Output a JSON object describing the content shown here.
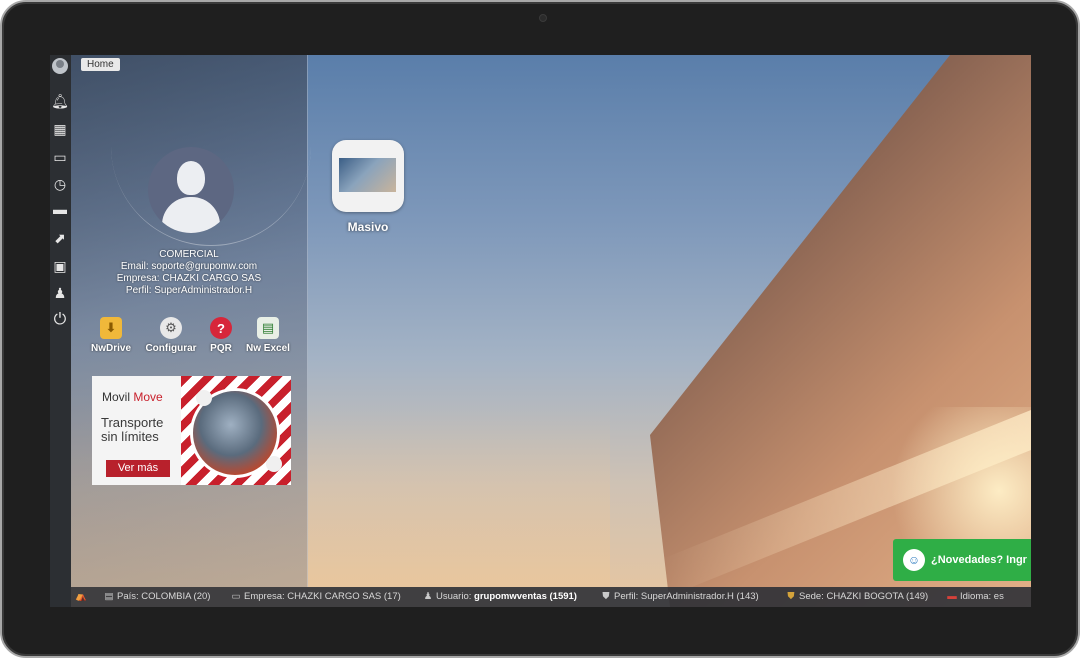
{
  "tabs": {
    "home": "Home"
  },
  "profile": {
    "role": "COMERCIAL",
    "email": "Email: soporte@grupomw.com",
    "company": "Empresa: CHAZKI CARGO SAS",
    "profile": "Perfil: SuperAdministrador.H"
  },
  "quick_actions": [
    {
      "label": "NwDrive",
      "icon": "drive-icon"
    },
    {
      "label": "Configurar",
      "icon": "gear-icon"
    },
    {
      "label": "PQR",
      "icon": "help-icon"
    },
    {
      "label": "Nw Excel",
      "icon": "excel-icon"
    }
  ],
  "ad": {
    "brand_a": "Movil ",
    "brand_b": "Move",
    "title_line1": "Transporte",
    "title_line2": "sin límites",
    "button": "Ver más"
  },
  "desktop": {
    "app_label": "Masivo"
  },
  "news": {
    "label": "¿Novedades? Ingr"
  },
  "statusbar": {
    "pais": "País: COLOMBIA (20)",
    "empresa": "Empresa: CHAZKI CARGO SAS (17)",
    "usuario_prefix": "Usuario: ",
    "usuario_value": "grupomwventas (1591)",
    "perfil": "Perfil: SuperAdministrador.H (143)",
    "sede": "Sede: CHAZKI BOGOTA (149)",
    "idioma": "Idioma: es"
  },
  "colors": {
    "accent_red": "#c8202c",
    "news_green": "#2fae46",
    "strip_bg": "#2c2f33"
  }
}
